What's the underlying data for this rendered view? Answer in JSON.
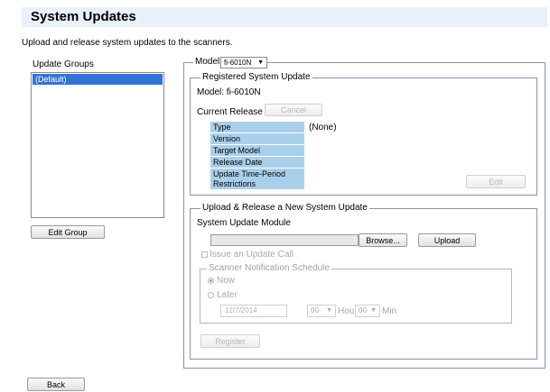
{
  "header": {
    "title": "System Updates"
  },
  "description": "Upload and release system updates to the scanners.",
  "groups": {
    "label": "Update Groups",
    "items": [
      "(Default)"
    ],
    "edit_button": "Edit Group"
  },
  "model_select": {
    "label": "Model:",
    "value": "fi-6010N"
  },
  "registered": {
    "legend": "Registered System Update",
    "model_text": "Model: fi-6010N",
    "current_release_label": "Current Release",
    "cancel_button": "Cancel",
    "rows": [
      {
        "label": "Type",
        "value": "(None)"
      },
      {
        "label": "Version",
        "value": ""
      },
      {
        "label": "Target Model",
        "value": ""
      },
      {
        "label": "Release Date",
        "value": ""
      },
      {
        "label": "Update Time-Period Restrictions",
        "value": ""
      }
    ],
    "edit_button": "Edit"
  },
  "upload": {
    "legend": "Upload & Release a New System Update",
    "module_label": "System Update Module",
    "file_value": "",
    "browse_button": "Browse...",
    "upload_button": "Upload",
    "issue_call_label": "Issue an Update Call",
    "schedule_legend": "Scanner Notification Schedule",
    "now_label": "Now",
    "later_label": "Later",
    "date_value": "12/7/2014",
    "hour_value": "00",
    "hour_label": "Hour",
    "min_value": "00",
    "min_label": "Min",
    "register_button": "Register"
  },
  "back_button": "Back",
  "colors": {
    "header_bg": "#e8f0fa",
    "selection": "#3372d6",
    "table_cell": "#a9d0ea",
    "frame": "#8294ad"
  }
}
